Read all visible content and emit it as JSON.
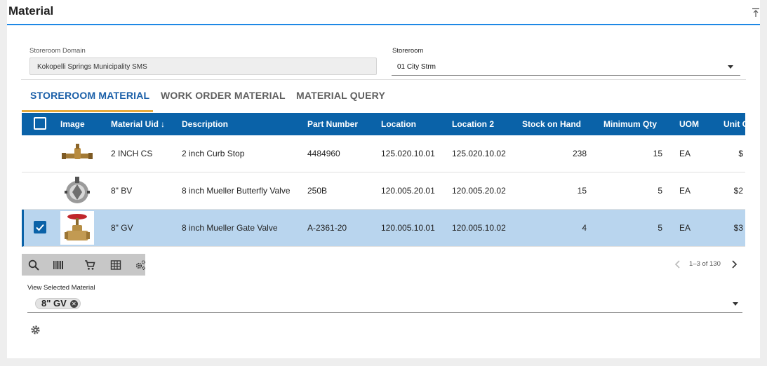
{
  "panel": {
    "title": "Material"
  },
  "storeroom_domain": {
    "label": "Storeroom Domain",
    "value": "Kokopelli Springs Municipality SMS"
  },
  "storeroom": {
    "label": "Storeroom",
    "value": "01 City Strm"
  },
  "tabs": [
    {
      "label": "STOREROOM MATERIAL",
      "active": true
    },
    {
      "label": "WORK ORDER MATERIAL",
      "active": false
    },
    {
      "label": "MATERIAL QUERY",
      "active": false
    }
  ],
  "grid": {
    "columns": {
      "image": "Image",
      "uid": "Material Uid",
      "description": "Description",
      "part": "Part Number",
      "location": "Location",
      "location2": "Location 2",
      "stock": "Stock on Hand",
      "minqty": "Minimum Qty",
      "uom": "UOM",
      "unitcost": "Unit C"
    },
    "rows": [
      {
        "uid": "2 INCH CS",
        "description": "2 inch Curb Stop",
        "part": "4484960",
        "location": "125.020.10.01",
        "location2": "125.020.10.02",
        "stock": "238",
        "minqty": "15",
        "uom": "EA",
        "unitcost": "$",
        "selected": false,
        "image": "curb-stop-image"
      },
      {
        "uid": "8\" BV",
        "description": "8 inch Mueller Butterfly Valve",
        "part": "250B",
        "location": "120.005.20.01",
        "location2": "120.005.20.02",
        "stock": "15",
        "minqty": "5",
        "uom": "EA",
        "unitcost": "$2",
        "selected": false,
        "image": "butterfly-valve-image"
      },
      {
        "uid": "8\" GV",
        "description": "8 inch Mueller Gate Valve",
        "part": "A-2361-20",
        "location": "120.005.10.01",
        "location2": "120.005.10.02",
        "stock": "4",
        "minqty": "5",
        "uom": "EA",
        "unitcost": "$3",
        "selected": true,
        "image": "gate-valve-image"
      }
    ]
  },
  "toolbar": {
    "icons": [
      "search-icon",
      "barcode-icon",
      "cart-icon",
      "table-icon",
      "settings-cogs-icon"
    ]
  },
  "pager": {
    "text": "1–3 of 130"
  },
  "view_selected": {
    "label": "View Selected Material",
    "chip": "8\" GV"
  },
  "colors": {
    "header": "#0a62a8",
    "selected_row": "#b9d5ee",
    "tab_accent": "#e6ab3e",
    "active_tab": "#1a5fa8"
  }
}
